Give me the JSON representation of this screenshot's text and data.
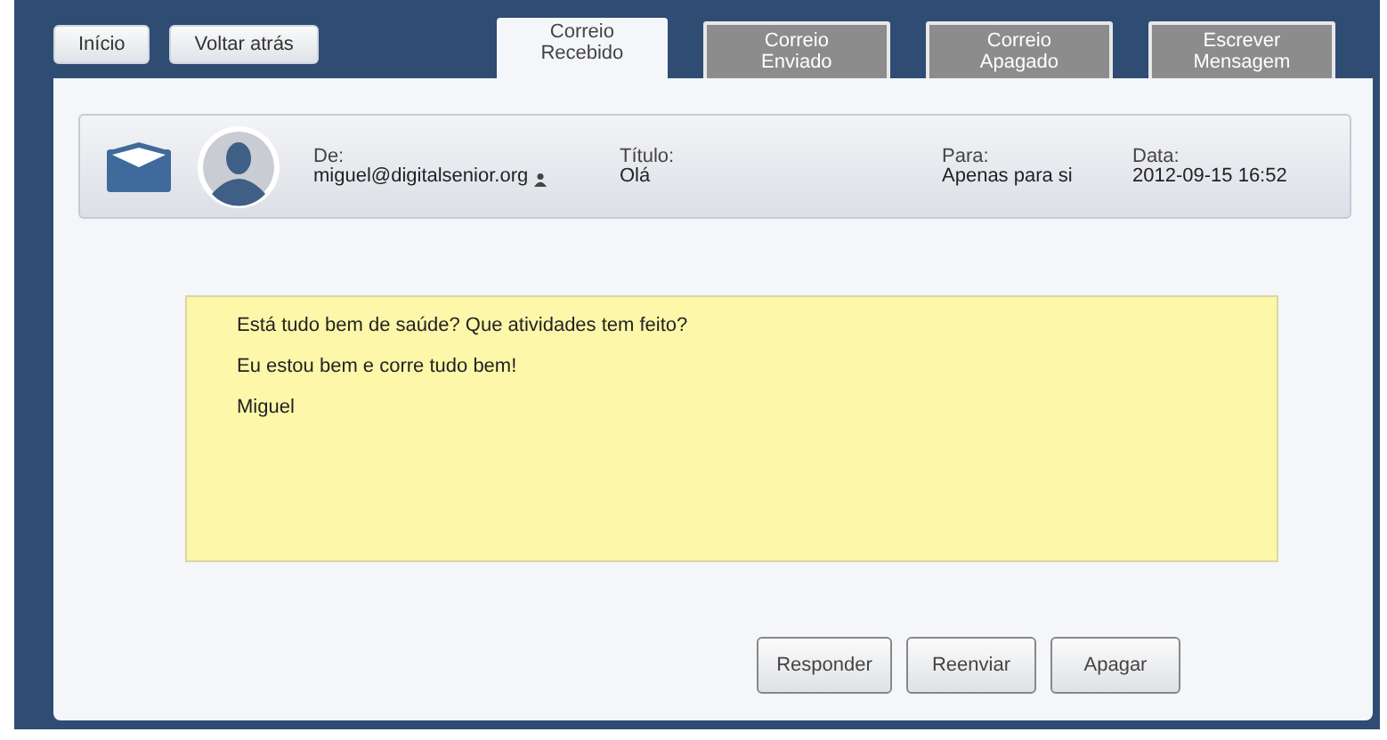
{
  "nav_buttons": [
    "Início",
    "Voltar atrás"
  ],
  "tabs": [
    {
      "label": "Correio\nRecebido",
      "selected": true
    },
    {
      "label": "Correio\nEnviado",
      "selected": false
    },
    {
      "label": "Correio\nApagado",
      "selected": false
    },
    {
      "label": "Escrever\nMensagem",
      "selected": false
    }
  ],
  "header": {
    "from_label": "De:",
    "from": "miguel@digitalsenior.org",
    "title_label": "Título:",
    "title": "Olá",
    "to_label": "Para:",
    "to": "Apenas para si",
    "date_label": "Data:",
    "date": "2012-09-15 16:52"
  },
  "message": [
    "Está tudo bem  de saúde? Que atividades tem feito?",
    "Eu estou bem e corre tudo bem!",
    "Miguel"
  ],
  "actions": [
    "Responder",
    "Reenviar",
    "Apagar"
  ]
}
